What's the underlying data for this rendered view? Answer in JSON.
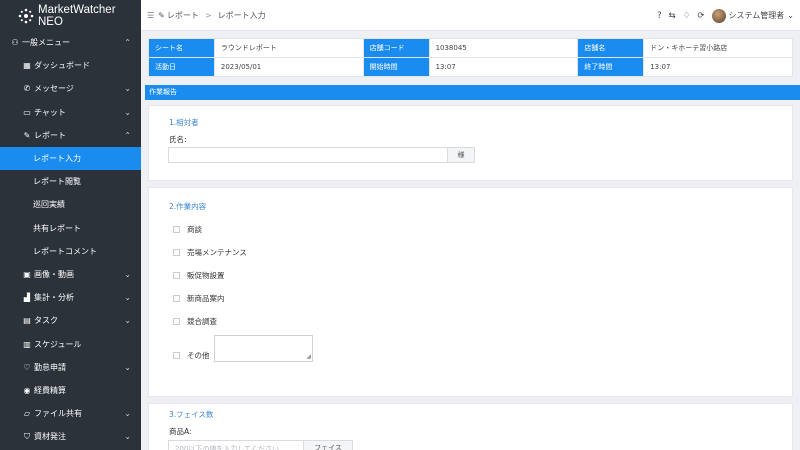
{
  "brand": {
    "name": "MarketWatcher NEO",
    "icon": "brand-logo-icon"
  },
  "sidebar": {
    "items": [
      {
        "label": "一般メニュー",
        "icon": "user-icon",
        "chev": "⌃",
        "level": "top"
      },
      {
        "label": "ダッシュボード",
        "icon": "grid-icon",
        "chev": ""
      },
      {
        "label": "メッセージ",
        "icon": "message-icon",
        "chev": "⌄"
      },
      {
        "label": "チャット",
        "icon": "chat-icon",
        "chev": "⌄"
      },
      {
        "label": "レポート",
        "icon": "pencil-icon",
        "chev": "⌃"
      },
      {
        "label": "レポート入力",
        "sub": true,
        "active": true
      },
      {
        "label": "レポート閲覧",
        "sub": true
      },
      {
        "label": "巡回実績",
        "sub": true
      },
      {
        "label": "共有レポート",
        "sub": true
      },
      {
        "label": "レポートコメント",
        "sub": true
      },
      {
        "label": "画像・動画",
        "icon": "image-icon",
        "chev": "⌄"
      },
      {
        "label": "集計・分析",
        "icon": "chart-icon",
        "chev": "⌄"
      },
      {
        "label": "タスク",
        "icon": "task-icon",
        "chev": "⌄"
      },
      {
        "label": "スケジュール",
        "icon": "calendar-icon",
        "chev": ""
      },
      {
        "label": "勤怠申請",
        "icon": "attendance-icon",
        "chev": "⌄"
      },
      {
        "label": "経費精算",
        "icon": "expense-icon",
        "chev": ""
      },
      {
        "label": "ファイル共有",
        "icon": "folder-icon",
        "chev": "⌄"
      },
      {
        "label": "資材発注",
        "icon": "cart-icon",
        "chev": "⌄"
      }
    ]
  },
  "topbar": {
    "breadcrumb": [
      "レポート",
      "レポート入力"
    ],
    "user": "システム管理者"
  },
  "info": {
    "rows": [
      [
        {
          "h": "シート名",
          "v": "ラウンドレポート"
        },
        {
          "h": "店舗コード",
          "v": "1038045"
        },
        {
          "h": "店舗名",
          "v": "ドン・キホーテ習小路店"
        }
      ],
      [
        {
          "h": "活動日",
          "v": "2023/05/01"
        },
        {
          "h": "開始時間",
          "v": "13:07"
        },
        {
          "h": "終了時間",
          "v": "13:07"
        }
      ]
    ]
  },
  "section_title": "作業報告",
  "respondent": {
    "title": "1.相対者",
    "name_label": "氏名:",
    "name_value": "",
    "suffix": "様"
  },
  "work": {
    "title": "2.作業内容",
    "options": [
      "商談",
      "売場メンテナンス",
      "販促物設置",
      "新商品案内",
      "競合調査"
    ],
    "other_label": "その他",
    "other_value": ""
  },
  "faces": {
    "title": "3.フェイス数",
    "product_label": "商品A:",
    "placeholder": "200以下の値を入力してください",
    "unit": "フェイス"
  }
}
